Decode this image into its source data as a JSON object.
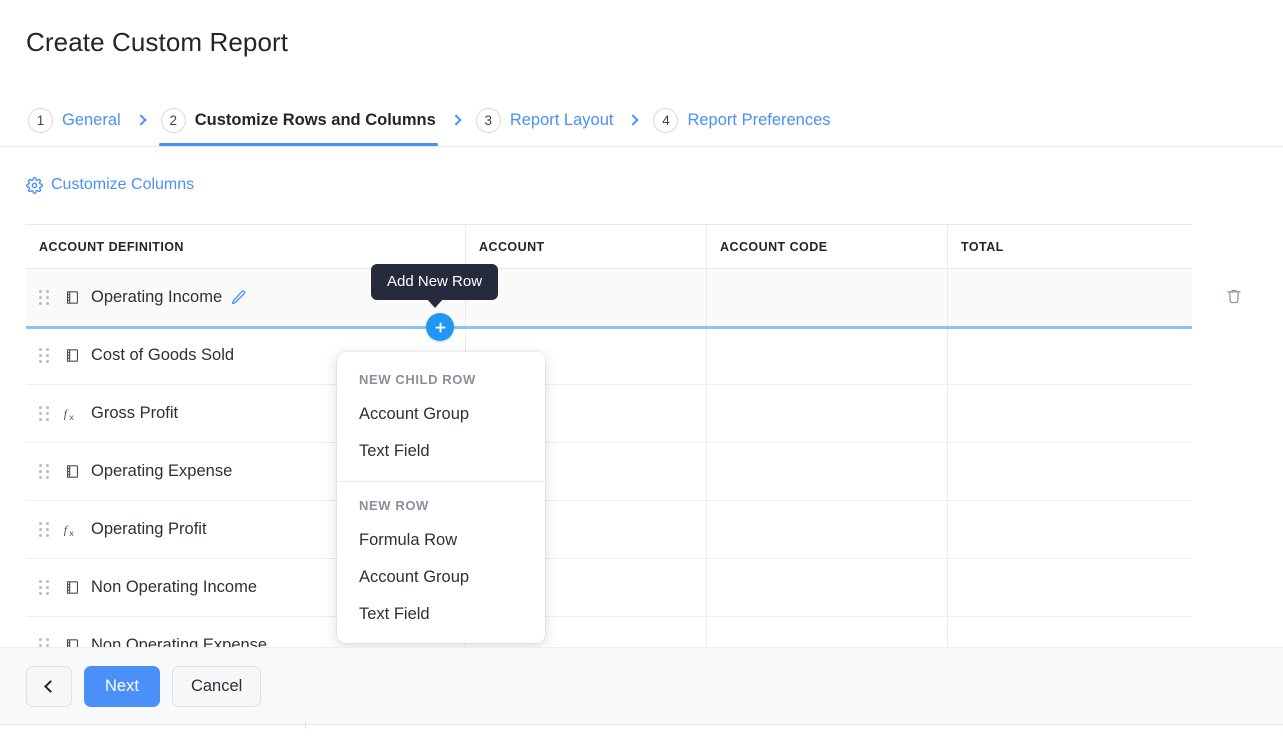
{
  "page_title": "Create Custom Report",
  "accent_color": "#4a90f7",
  "stepper": {
    "separator_icon": "chevron-right-icon",
    "steps": [
      {
        "num": "1",
        "label": "General",
        "active": false
      },
      {
        "num": "2",
        "label": "Customize Rows and Columns",
        "active": true
      },
      {
        "num": "3",
        "label": "Report Layout",
        "active": false
      },
      {
        "num": "4",
        "label": "Report Preferences",
        "active": false
      }
    ]
  },
  "customize_columns": {
    "label": "Customize Columns",
    "icon": "gear-icon"
  },
  "table": {
    "columns": [
      {
        "key": "account_definition",
        "label": "ACCOUNT DEFINITION"
      },
      {
        "key": "account",
        "label": "ACCOUNT"
      },
      {
        "key": "account_code",
        "label": "ACCOUNT CODE"
      },
      {
        "key": "total",
        "label": "TOTAL"
      }
    ],
    "rows": [
      {
        "label": "Operating Income",
        "type_icon": "ledger-icon",
        "selected": true,
        "editable": true,
        "edit_icon": "pencil-icon",
        "account": "",
        "account_code": "",
        "total": ""
      },
      {
        "label": "Cost of Goods Sold",
        "type_icon": "ledger-icon",
        "selected": false,
        "editable": false,
        "account": "",
        "account_code": "",
        "total": ""
      },
      {
        "label": "Gross Profit",
        "type_icon": "formula-icon",
        "selected": false,
        "editable": false,
        "account": "",
        "account_code": "",
        "total": ""
      },
      {
        "label": "Operating Expense",
        "type_icon": "ledger-icon",
        "selected": false,
        "editable": false,
        "account": "",
        "account_code": "",
        "total": ""
      },
      {
        "label": "Operating Profit",
        "type_icon": "formula-icon",
        "selected": false,
        "editable": false,
        "account": "",
        "account_code": "",
        "total": ""
      },
      {
        "label": "Non Operating Income",
        "type_icon": "ledger-icon",
        "selected": false,
        "editable": false,
        "account": "",
        "account_code": "",
        "total": ""
      },
      {
        "label": "Non Operating Expense",
        "type_icon": "ledger-icon",
        "selected": false,
        "editable": false,
        "account": "",
        "account_code": "",
        "total": ""
      }
    ],
    "row_delete_icon": "trash-icon",
    "drag_handle_icon": "drag-handle-icon"
  },
  "add_row": {
    "tooltip": "Add New Row",
    "button_icon": "plus-icon"
  },
  "add_row_menu": {
    "sections": [
      {
        "title": "NEW CHILD ROW",
        "items": [
          "Account Group",
          "Text Field"
        ]
      },
      {
        "title": "NEW ROW",
        "items": [
          "Formula Row",
          "Account Group",
          "Text Field"
        ]
      }
    ]
  },
  "footer": {
    "back_icon": "chevron-left-icon",
    "next_label": "Next",
    "cancel_label": "Cancel"
  }
}
